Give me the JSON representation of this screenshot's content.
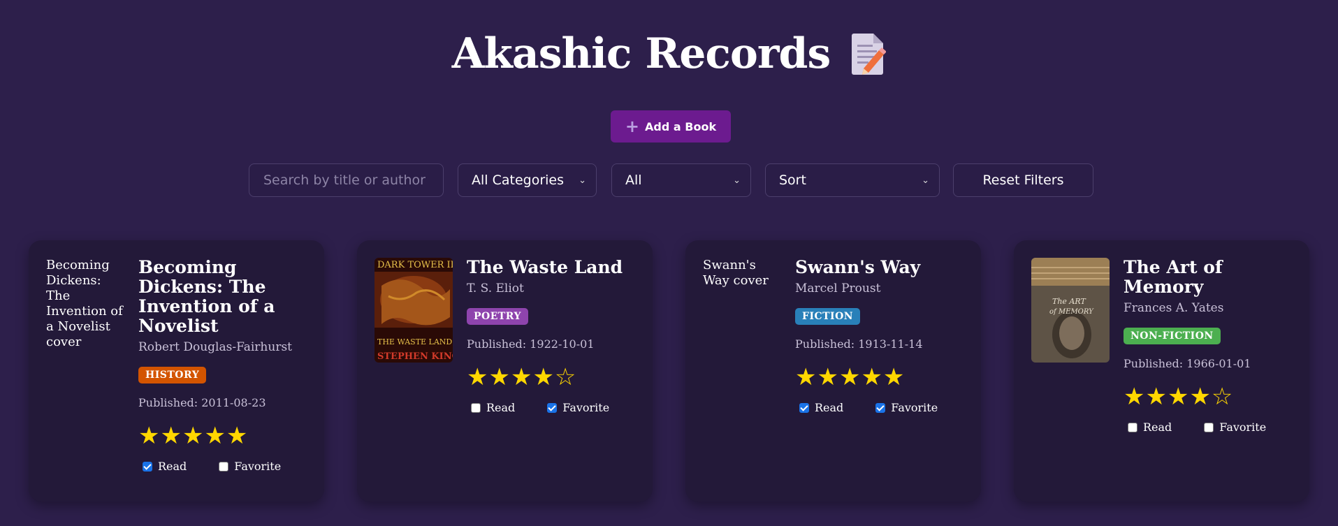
{
  "header": {
    "title": "Akashic Records",
    "icon": "memo-icon"
  },
  "toolbar": {
    "add_label": "Add a Book",
    "add_icon": "plus-icon"
  },
  "filters": {
    "search_placeholder": "Search by title or author",
    "category": "All Categories",
    "status": "All",
    "sort": "Sort",
    "reset_label": "Reset Filters"
  },
  "colors": {
    "background": "#2d1f4b",
    "card": "#231939",
    "accent": "#6c1b8f",
    "history": "#d35400",
    "poetry": "#8e44ad",
    "fiction": "#2980b9",
    "nonfiction": "#4caf50",
    "star": "#ffd700"
  },
  "books": [
    {
      "title": "Becoming Dickens: The Invention of a Novelist",
      "author": "Robert Douglas-Fairhurst",
      "category": "HISTORY",
      "published": "Published: 2011-08-23",
      "stars": "★★★★★",
      "rating": 5,
      "cover_alt": "Becoming Dickens: The Invention of a Novelist cover",
      "read_label": "Read",
      "read": true,
      "favorite_label": "Favorite",
      "favorite": false
    },
    {
      "title": "The Waste Land",
      "author": "T. S. Eliot",
      "category": "POETRY",
      "published": "Published: 1922-10-01",
      "stars": "★★★★☆",
      "rating": 4,
      "cover_text": {
        "top": "DARK TOWER III:",
        "middle": "THE WASTE LANDS",
        "bottom": "STEPHEN KING"
      },
      "read_label": "Read",
      "read": false,
      "favorite_label": "Favorite",
      "favorite": true
    },
    {
      "title": "Swann's Way",
      "author": "Marcel Proust",
      "category": "FICTION",
      "published": "Published: 1913-11-14",
      "stars": "★★★★★",
      "rating": 5,
      "cover_alt": "Swann's Way cover",
      "read_label": "Read",
      "read": true,
      "favorite_label": "Favorite",
      "favorite": true
    },
    {
      "title": "The Art of Memory",
      "author": "Frances A. Yates",
      "category": "NON-FICTION",
      "published": "Published: 1966-01-01",
      "stars": "★★★★☆",
      "rating": 4,
      "cover_text": {
        "line1": "The ART",
        "line2": "of MEMORY"
      },
      "read_label": "Read",
      "read": false,
      "favorite_label": "Favorite",
      "favorite": false
    }
  ]
}
